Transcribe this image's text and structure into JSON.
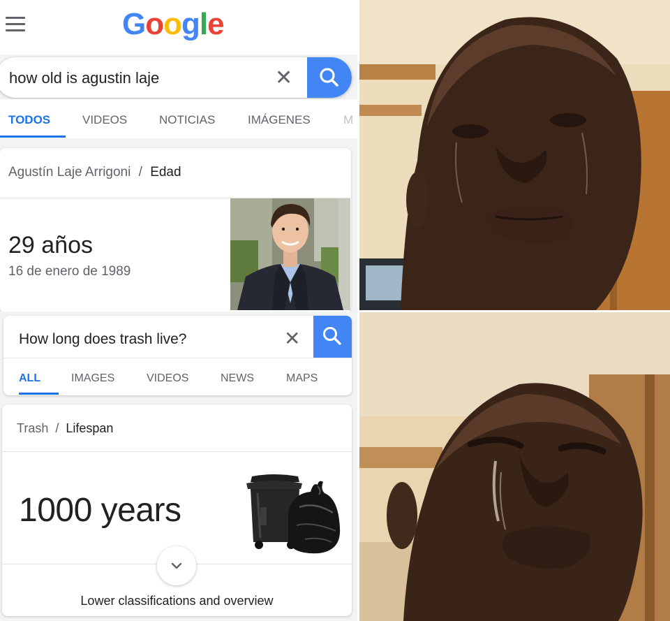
{
  "colors": {
    "accent": "#1a73e8",
    "search_button": "#4285f4",
    "background": "#f1f3f4"
  },
  "search1": {
    "logo": [
      "G",
      "o",
      "o",
      "g",
      "l",
      "e"
    ],
    "logo_colors": [
      "#4285f4",
      "#ea4335",
      "#fbbc05",
      "#4285f4",
      "#34a853",
      "#ea4335"
    ],
    "query": "how old is agustin laje",
    "clear_icon": "close-icon",
    "search_icon": "search-icon",
    "menu_icon": "hamburger-menu-icon",
    "tabs": [
      "TODOS",
      "VIDEOS",
      "NOTICIAS",
      "IMÁGENES",
      "M"
    ],
    "active_tab": "TODOS",
    "breadcrumb_entity": "Agustín Laje Arrigoni",
    "breadcrumb_sep": "/",
    "breadcrumb_attr": "Edad",
    "answer": "29 años",
    "detail": "16 de enero de 1989"
  },
  "search2": {
    "query": "How long does trash live?",
    "clear_icon": "close-icon",
    "search_icon": "search-icon",
    "tabs": [
      "ALL",
      "IMAGES",
      "VIDEOS",
      "NEWS",
      "MAPS"
    ],
    "active_tab": "ALL",
    "breadcrumb_entity": "Trash",
    "breadcrumb_sep": "/",
    "breadcrumb_attr": "Lifespan",
    "answer": "1000 years",
    "expand_icon": "chevron-down-icon",
    "more_label": "Lower classifications and overview"
  },
  "reaction_images": [
    "crying-man-tears",
    "crying-man-sobbing"
  ]
}
